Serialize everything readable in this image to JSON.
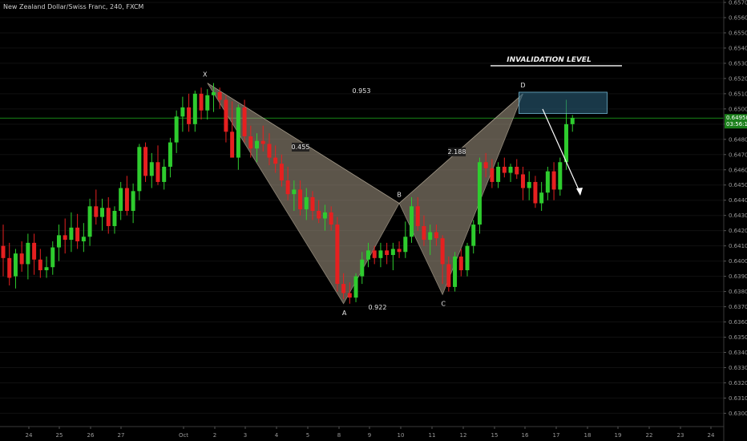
{
  "header": {
    "title": "New Zealand Dollar/Swiss Franc, 240, FXCM"
  },
  "colors": {
    "up": "#2ecc2e",
    "down": "#e62020",
    "grid": "#111111",
    "pattern_fill": "#a89a86",
    "box_fill": "#2a5e78",
    "box_stroke": "#6fb4cf",
    "price_line": "#1fae1f"
  },
  "chart_data": {
    "type": "candlestick",
    "x_ticks": [
      "24",
      "25",
      "26",
      "27",
      "Oct",
      "2",
      "3",
      "4",
      "5",
      "8",
      "9",
      "10",
      "11",
      "12",
      "15",
      "16",
      "17",
      "18",
      "19",
      "22",
      "23",
      "24"
    ],
    "y_ticks": [
      "0.65700",
      "0.65600",
      "0.65500",
      "0.65400",
      "0.65300",
      "0.65200",
      "0.65100",
      "0.65000",
      "0.64900",
      "0.64800",
      "0.64700",
      "0.64600",
      "0.64500",
      "0.64400",
      "0.64300",
      "0.64200",
      "0.64100",
      "0.64000",
      "0.63900",
      "0.63800",
      "0.63700",
      "0.63600",
      "0.63500",
      "0.63400",
      "0.63300",
      "0.63200",
      "0.63100",
      "0.63000"
    ],
    "ylim": [
      0.6296,
      0.657
    ],
    "current_price": {
      "value": 0.6494,
      "label": "0.64950",
      "countdown": "03:56:10"
    },
    "candles": [
      [
        0.641,
        0.6424,
        0.639,
        0.6402
      ],
      [
        0.6402,
        0.6412,
        0.6384,
        0.6389
      ],
      [
        0.639,
        0.6408,
        0.6382,
        0.6405
      ],
      [
        0.6405,
        0.6413,
        0.6393,
        0.6398
      ],
      [
        0.6398,
        0.6418,
        0.6388,
        0.6412
      ],
      [
        0.6412,
        0.6418,
        0.6391,
        0.6401
      ],
      [
        0.6401,
        0.6408,
        0.6389,
        0.6394
      ],
      [
        0.6394,
        0.6403,
        0.6389,
        0.6396
      ],
      [
        0.6396,
        0.6413,
        0.6391,
        0.6409
      ],
      [
        0.6409,
        0.6424,
        0.64,
        0.6417
      ],
      [
        0.6417,
        0.6428,
        0.6405,
        0.6414
      ],
      [
        0.6414,
        0.6432,
        0.6406,
        0.6422
      ],
      [
        0.6422,
        0.6431,
        0.6408,
        0.6413
      ],
      [
        0.6413,
        0.6425,
        0.6406,
        0.6416
      ],
      [
        0.6416,
        0.6441,
        0.641,
        0.6436
      ],
      [
        0.6436,
        0.6447,
        0.6424,
        0.6429
      ],
      [
        0.6429,
        0.6441,
        0.642,
        0.6435
      ],
      [
        0.6435,
        0.6442,
        0.6418,
        0.6423
      ],
      [
        0.6423,
        0.6436,
        0.6418,
        0.6433
      ],
      [
        0.6433,
        0.6452,
        0.6427,
        0.6448
      ],
      [
        0.6448,
        0.6456,
        0.643,
        0.6433
      ],
      [
        0.6433,
        0.6451,
        0.6425,
        0.6446
      ],
      [
        0.6446,
        0.6477,
        0.644,
        0.6475
      ],
      [
        0.6475,
        0.6478,
        0.6452,
        0.6456
      ],
      [
        0.6456,
        0.6471,
        0.6448,
        0.6465
      ],
      [
        0.6465,
        0.6476,
        0.645,
        0.6452
      ],
      [
        0.6452,
        0.6467,
        0.6447,
        0.6462
      ],
      [
        0.6462,
        0.6481,
        0.6455,
        0.6478
      ],
      [
        0.6478,
        0.6499,
        0.6471,
        0.6495
      ],
      [
        0.6495,
        0.6508,
        0.6485,
        0.6501
      ],
      [
        0.6501,
        0.651,
        0.6485,
        0.649
      ],
      [
        0.649,
        0.6512,
        0.6485,
        0.651
      ],
      [
        0.651,
        0.6514,
        0.6493,
        0.6499
      ],
      [
        0.6499,
        0.6513,
        0.6493,
        0.6509
      ],
      [
        0.6509,
        0.6517,
        0.6498,
        0.6511
      ],
      [
        0.6511,
        0.6514,
        0.65,
        0.6506
      ],
      [
        0.6506,
        0.6509,
        0.6478,
        0.6485
      ],
      [
        0.6485,
        0.6505,
        0.647,
        0.6468
      ],
      [
        0.6468,
        0.6503,
        0.646,
        0.6501
      ],
      [
        0.6501,
        0.6506,
        0.6478,
        0.6482
      ],
      [
        0.6482,
        0.6489,
        0.6468,
        0.6474
      ],
      [
        0.6474,
        0.6484,
        0.6465,
        0.6479
      ],
      [
        0.6479,
        0.6489,
        0.6472,
        0.6477
      ],
      [
        0.6477,
        0.6484,
        0.6463,
        0.6468
      ],
      [
        0.6468,
        0.6476,
        0.6458,
        0.6464
      ],
      [
        0.6464,
        0.647,
        0.6449,
        0.6453
      ],
      [
        0.6453,
        0.6462,
        0.644,
        0.6444
      ],
      [
        0.6444,
        0.6453,
        0.6433,
        0.6447
      ],
      [
        0.6447,
        0.6453,
        0.643,
        0.6434
      ],
      [
        0.6434,
        0.6448,
        0.6427,
        0.6442
      ],
      [
        0.6442,
        0.6446,
        0.6427,
        0.6433
      ],
      [
        0.6433,
        0.644,
        0.6425,
        0.6428
      ],
      [
        0.6428,
        0.6437,
        0.642,
        0.6432
      ],
      [
        0.6432,
        0.6436,
        0.642,
        0.6424
      ],
      [
        0.6424,
        0.6429,
        0.638,
        0.6385
      ],
      [
        0.6385,
        0.6392,
        0.6375,
        0.6379
      ],
      [
        0.6379,
        0.6386,
        0.6372,
        0.6376
      ],
      [
        0.6376,
        0.6392,
        0.6373,
        0.639
      ],
      [
        0.639,
        0.6406,
        0.6385,
        0.6401
      ],
      [
        0.6401,
        0.6412,
        0.6396,
        0.6407
      ],
      [
        0.6407,
        0.641,
        0.6398,
        0.6402
      ],
      [
        0.6402,
        0.6412,
        0.6396,
        0.6407
      ],
      [
        0.6407,
        0.6412,
        0.6398,
        0.6404
      ],
      [
        0.6404,
        0.6412,
        0.6394,
        0.6408
      ],
      [
        0.6408,
        0.6413,
        0.6402,
        0.6406
      ],
      [
        0.6406,
        0.6426,
        0.6402,
        0.6416
      ],
      [
        0.6416,
        0.6442,
        0.6412,
        0.6436
      ],
      [
        0.6436,
        0.6442,
        0.642,
        0.6423
      ],
      [
        0.6423,
        0.643,
        0.641,
        0.6414
      ],
      [
        0.6414,
        0.6424,
        0.6404,
        0.6419
      ],
      [
        0.6419,
        0.6424,
        0.641,
        0.6415
      ],
      [
        0.6415,
        0.6417,
        0.6385,
        0.6398
      ],
      [
        0.6398,
        0.6403,
        0.638,
        0.6383
      ],
      [
        0.6383,
        0.6406,
        0.638,
        0.6403
      ],
      [
        0.6403,
        0.6408,
        0.639,
        0.6394
      ],
      [
        0.6394,
        0.6412,
        0.639,
        0.641
      ],
      [
        0.641,
        0.6427,
        0.6405,
        0.6424
      ],
      [
        0.6424,
        0.6468,
        0.6418,
        0.6465
      ],
      [
        0.6465,
        0.6471,
        0.6455,
        0.6461
      ],
      [
        0.6461,
        0.6467,
        0.6448,
        0.6452
      ],
      [
        0.6452,
        0.6465,
        0.6448,
        0.6462
      ],
      [
        0.6462,
        0.6468,
        0.6455,
        0.6458
      ],
      [
        0.6458,
        0.6464,
        0.6452,
        0.6462
      ],
      [
        0.6462,
        0.6467,
        0.6454,
        0.6457
      ],
      [
        0.6457,
        0.6462,
        0.644,
        0.6448
      ],
      [
        0.6448,
        0.6459,
        0.644,
        0.6452
      ],
      [
        0.6452,
        0.6456,
        0.6435,
        0.6438
      ],
      [
        0.6438,
        0.6452,
        0.6433,
        0.6445
      ],
      [
        0.6445,
        0.6462,
        0.644,
        0.6459
      ],
      [
        0.6459,
        0.6465,
        0.644,
        0.6447
      ],
      [
        0.6447,
        0.6468,
        0.6443,
        0.6465
      ],
      [
        0.6465,
        0.6506,
        0.646,
        0.649
      ],
      [
        0.649,
        0.6496,
        0.6485,
        0.6494
      ]
    ],
    "pattern_points": [
      {
        "label": "X",
        "index": 33,
        "price": 0.6517
      },
      {
        "label": "A",
        "index": 55,
        "price": 0.6372
      },
      {
        "label": "B",
        "index": 64,
        "price": 0.6438
      },
      {
        "label": "C",
        "index": 71,
        "price": 0.6378
      },
      {
        "label": "D",
        "index": 84,
        "price": 0.651
      }
    ],
    "ratios": [
      {
        "value": "0.953",
        "near": "XD"
      },
      {
        "value": "0.455",
        "near": "XB"
      },
      {
        "value": "0.922",
        "near": "AC"
      },
      {
        "value": "2.188",
        "near": "BD"
      }
    ],
    "invalidation": {
      "label": "INVALIDATION LEVEL"
    },
    "zone": {
      "price_top": 0.6511,
      "price_bottom": 0.6497
    }
  }
}
